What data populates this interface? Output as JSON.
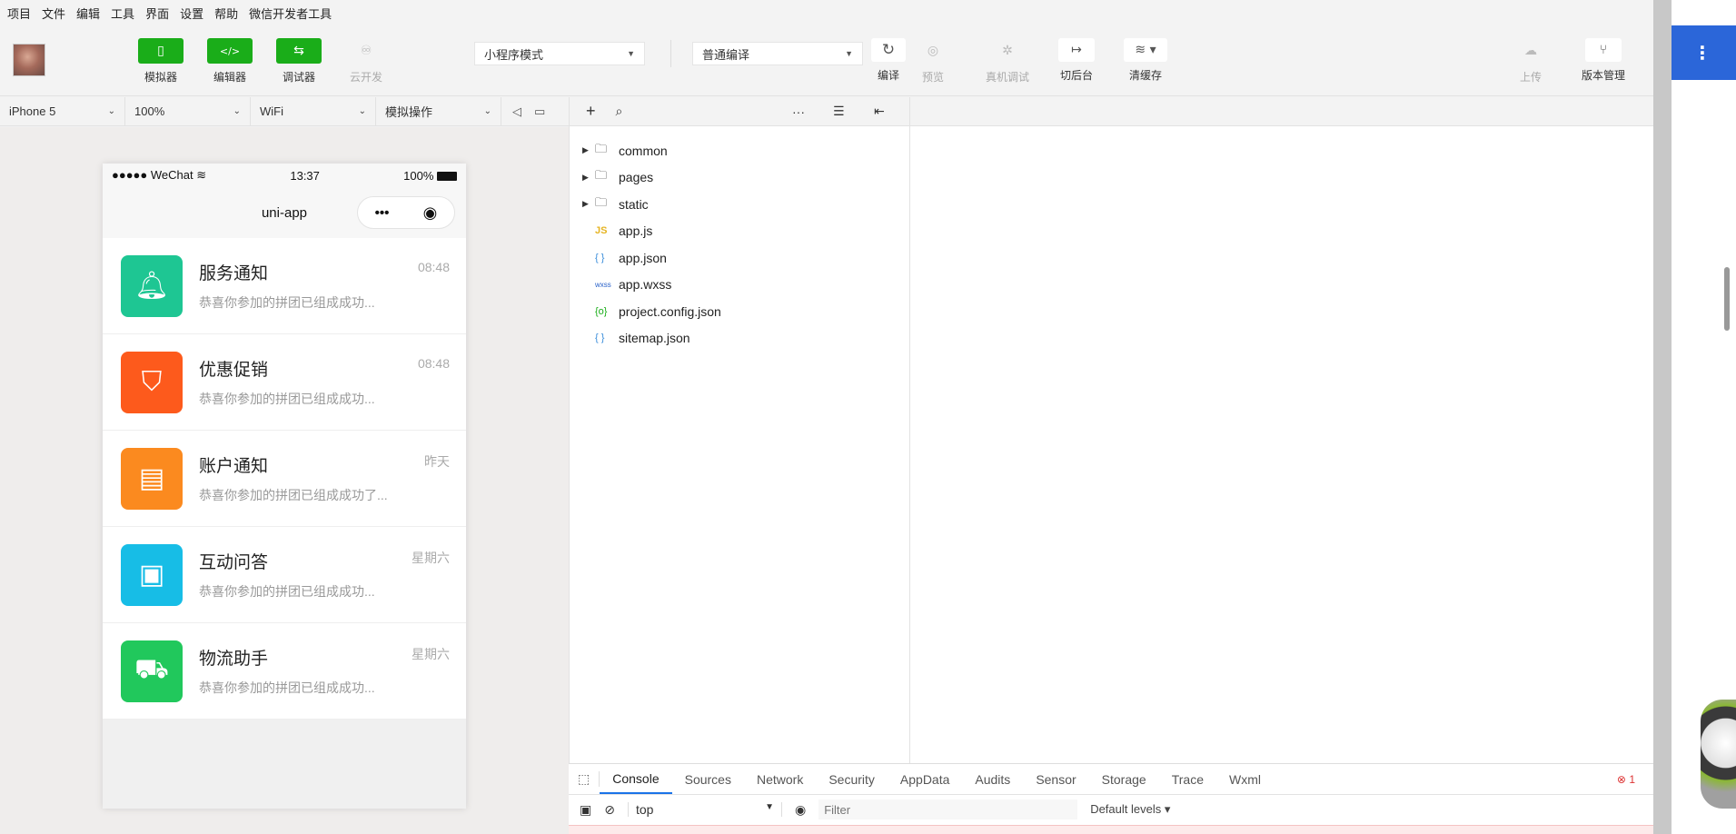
{
  "menubar": {
    "items": [
      "项目",
      "文件",
      "编辑",
      "工具",
      "界面",
      "设置",
      "帮助",
      "微信开发者工具"
    ]
  },
  "toolbar": {
    "simulator": "模拟器",
    "editor": "编辑器",
    "debugger": "调试器",
    "cloud_dev": "云开发",
    "mode_select": "小程序模式",
    "compile_select": "普通编译",
    "compile": "编译",
    "preview": "预览",
    "real_debug": "真机调试",
    "background": "切后台",
    "clear_cache": "清缓存",
    "upload": "上传",
    "version_mgmt": "版本管理"
  },
  "devicebar": {
    "device": "iPhone 5",
    "zoom": "100%",
    "network": "WiFi",
    "operation": "模拟操作"
  },
  "phone": {
    "status_left": "●●●●● WeChat",
    "status_time": "13:37",
    "status_battery": "100%",
    "nav_title": "uni-app",
    "capsule_more": "•••",
    "messages": [
      {
        "title": "服务通知",
        "subtitle": "恭喜你参加的拼团已组成成功...",
        "time": "08:48",
        "color": "#1ec693",
        "icon": "bell-icon"
      },
      {
        "title": "优惠促销",
        "subtitle": "恭喜你参加的拼团已组成成功...",
        "time": "08:48",
        "color": "#fd5a1c",
        "icon": "tag-icon"
      },
      {
        "title": "账户通知",
        "subtitle": "恭喜你参加的拼团已组成成功了...",
        "time": "昨天",
        "color": "#fb8a1f",
        "icon": "wallet-icon"
      },
      {
        "title": "互动问答",
        "subtitle": "恭喜你参加的拼团已组成成功...",
        "time": "星期六",
        "color": "#17bde6",
        "icon": "chat-icon"
      },
      {
        "title": "物流助手",
        "subtitle": "恭喜你参加的拼团已组成成功...",
        "time": "星期六",
        "color": "#21c85c",
        "icon": "truck-icon"
      }
    ]
  },
  "explorer": {
    "folders": [
      "common",
      "pages",
      "static"
    ],
    "files": [
      {
        "badge": "JS",
        "badge_color": "#e6b422",
        "name": "app.js"
      },
      {
        "badge": "{ }",
        "badge_color": "#3b8edb",
        "name": "app.json"
      },
      {
        "badge": "wxss",
        "badge_color": "#2a62c9",
        "name": "app.wxss"
      },
      {
        "badge": "{o}",
        "badge_color": "#1aad19",
        "name": "project.config.json"
      },
      {
        "badge": "{ }",
        "badge_color": "#3b8edb",
        "name": "sitemap.json"
      }
    ]
  },
  "devtools": {
    "tabs": [
      "Console",
      "Sources",
      "Network",
      "Security",
      "AppData",
      "Audits",
      "Sensor",
      "Storage",
      "Trace",
      "Wxml"
    ],
    "context": "top",
    "filter_placeholder": "Filter",
    "levels": "Default levels ▾",
    "error_count": "1"
  }
}
